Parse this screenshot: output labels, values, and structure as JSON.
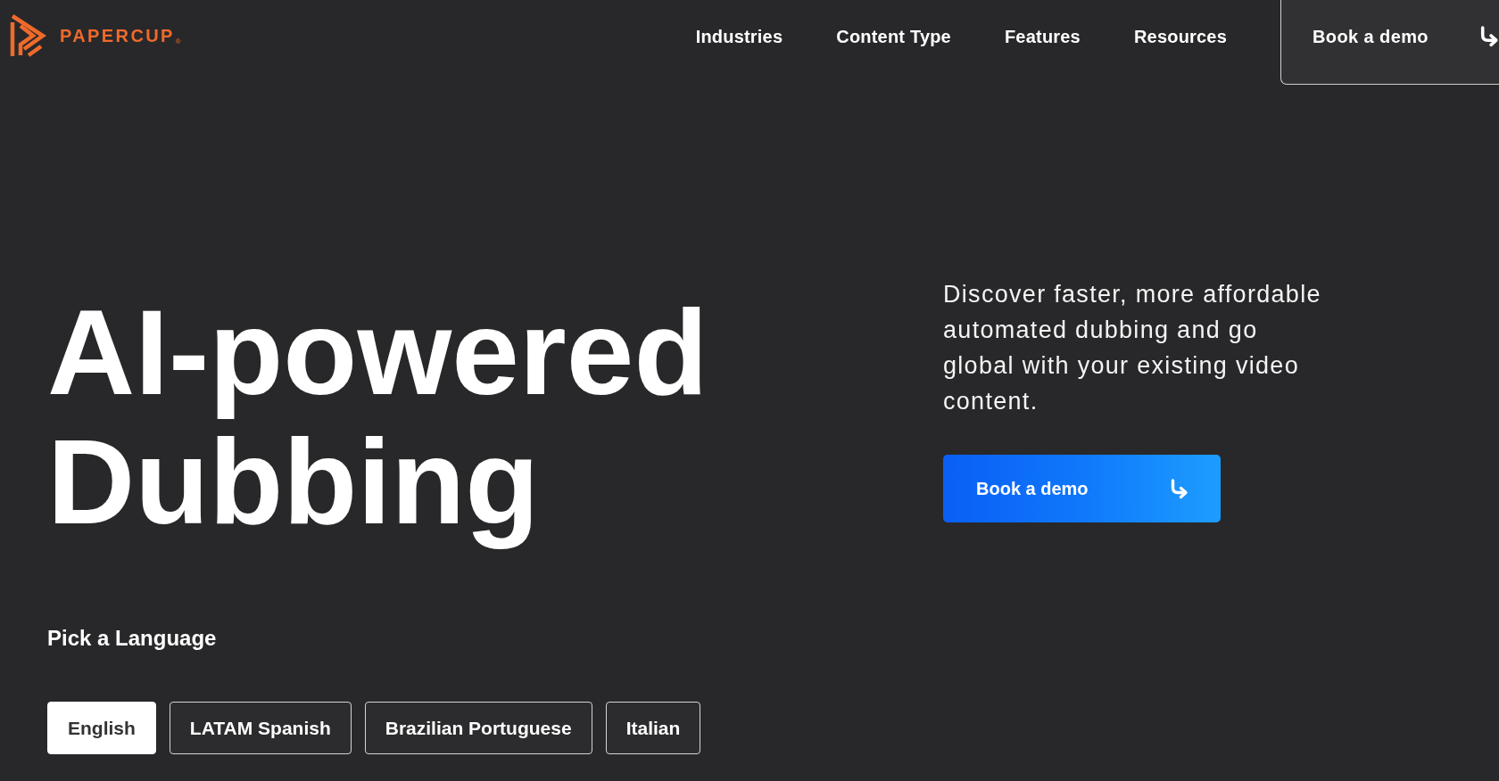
{
  "header": {
    "logo": {
      "wordmark": "PAPERCUP",
      "registered_mark": "®"
    },
    "nav": [
      "Industries",
      "Content Type",
      "Features",
      "Resources"
    ],
    "cta": {
      "label": "Book a demo"
    }
  },
  "hero": {
    "heading": "AI-powered Dubbing",
    "description": "Discover faster, more affordable automated dubbing and go global with your existing video content.",
    "cta": {
      "label": "Book a demo"
    }
  },
  "language_picker": {
    "title": "Pick a Language",
    "options": [
      {
        "label": "English",
        "selected": true
      },
      {
        "label": "LATAM Spanish",
        "selected": false
      },
      {
        "label": "Brazilian Portuguese",
        "selected": false
      },
      {
        "label": "Italian",
        "selected": false
      }
    ]
  }
}
